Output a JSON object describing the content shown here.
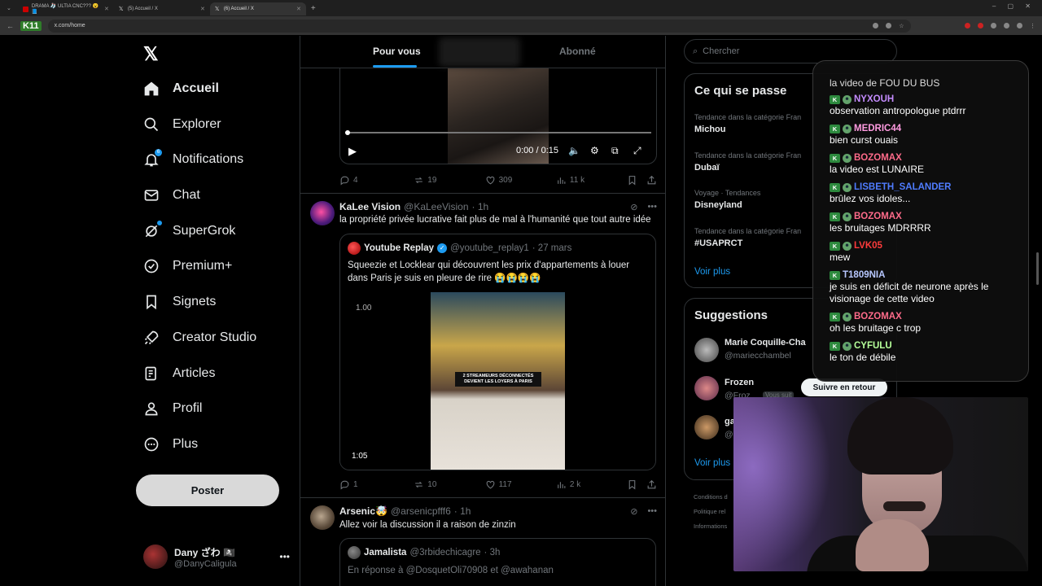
{
  "browser": {
    "tabs": [
      {
        "label": "DRAMA 🧦 ULTIA CNC??? 😮📘",
        "icon": "youtube-icon"
      },
      {
        "label": "(5) Accueil / X",
        "icon": "x-icon"
      },
      {
        "label": "(6) Accueil / X",
        "icon": "x-icon"
      }
    ],
    "url": "x.com/home",
    "stream_logo": "K11"
  },
  "nav": {
    "items": [
      {
        "label": "Accueil",
        "icon": "home-icon"
      },
      {
        "label": "Explorer",
        "icon": "search-icon"
      },
      {
        "label": "Notifications",
        "icon": "bell-icon",
        "badge": "6"
      },
      {
        "label": "Chat",
        "icon": "mail-icon"
      },
      {
        "label": "SuperGrok",
        "icon": "grok-icon"
      },
      {
        "label": "Premium+",
        "icon": "verified-icon"
      },
      {
        "label": "Signets",
        "icon": "bookmark-icon"
      },
      {
        "label": "Creator Studio",
        "icon": "rocket-icon"
      },
      {
        "label": "Articles",
        "icon": "article-icon"
      },
      {
        "label": "Profil",
        "icon": "person-icon"
      },
      {
        "label": "Plus",
        "icon": "more-circle-icon"
      }
    ],
    "post_label": "Poster",
    "profile": {
      "name": "Dany ざわ 🏴‍☠️",
      "handle": "@DanyCaligula"
    }
  },
  "feed": {
    "tabs": {
      "active": "Pour vous",
      "inactive": "Abonné"
    },
    "video1": {
      "time": "0:00 / 0:15",
      "progress": 0.0
    },
    "stats1": {
      "replies": "4",
      "reposts": "19",
      "likes": "309",
      "views": "11 k"
    },
    "tweet2": {
      "name": "KaLee Vision",
      "handle": "@KaLeeVision",
      "time": "· 1h",
      "text": "la propriété privée lucrative fait plus de mal à l'humanité que tout autre idée",
      "quote": {
        "name": "Youtube Replay",
        "handle": "@youtube_replay1",
        "time": "· 27 mars",
        "text": "Squeezie et Locklear qui découvrent les prix d'appartements à louer dans Paris je suis en pleure de rire 😭😭😭😭",
        "media_caption": "2 STREAMEURS DÉCONNECTÉS DEVIENT LES LOYERS À PARIS",
        "media_label": "1.00",
        "duration": "1:05"
      },
      "stats": {
        "replies": "1",
        "reposts": "10",
        "likes": "117",
        "views": "2 k"
      }
    },
    "tweet3": {
      "name": "Arsenic🤯",
      "handle": "@arsenicpfff6",
      "time": "· 1h",
      "text": "Allez voir la discussion il a raison de zinzin",
      "quote": {
        "name": "Jamalista",
        "handle": "@3rbidechicagre",
        "time": "· 3h",
        "reply_to": "En réponse à @DosquetOli70908  et  @awahanan"
      }
    }
  },
  "sidebar": {
    "search_placeholder": "Chercher",
    "trends_title": "Ce qui se passe",
    "trends": [
      {
        "meta": "Tendance dans la catégorie Fran",
        "name": "Michou"
      },
      {
        "meta": "Tendance dans la catégorie Fran",
        "name": "Dubaï"
      },
      {
        "meta": "Voyage · Tendances",
        "name": "Disneyland"
      },
      {
        "meta": "Tendance dans la catégorie Fran",
        "name": "#USAPRCT"
      }
    ],
    "see_more": "Voir plus",
    "suggestions_title": "Suggestions",
    "suggestions": [
      {
        "name": "Marie Coquille-Cha",
        "handle": "@mariecchambel"
      },
      {
        "name": "Frozen",
        "handle": "@Froz",
        "follows_you": "Vous suit"
      },
      {
        "name": "ga",
        "handle": "@"
      }
    ],
    "follow_back": "Suivre en retour",
    "see_more_2": "Voir plus",
    "footer": [
      "Conditions d",
      "Politique rel",
      "Informations"
    ]
  },
  "chat": {
    "top_text": "la video de FOU DU BUS",
    "messages": [
      {
        "user": "NYXOUH",
        "color": "#c58cff",
        "text": "observation antropologue ptdrrr"
      },
      {
        "user": "MEDRIC44",
        "color": "#ff9be0",
        "text": "bien curst ouais"
      },
      {
        "user": "BOZOMAX",
        "color": "#ff6b8a",
        "text": "la video est LUNAIRE"
      },
      {
        "user": "LISBETH_SALANDER",
        "color": "#4f7cff",
        "text": "brûlez vos idoles..."
      },
      {
        "user": "BOZOMAX",
        "color": "#ff6b8a",
        "text": "les bruitages MDRRRR"
      },
      {
        "user": "LVK05",
        "color": "#ff3b3b",
        "text": "mew"
      },
      {
        "user": "T1809NIA",
        "color": "#b7c7ff",
        "text": "je suis en déficit de neurone après le visionage de cette video"
      },
      {
        "user": "BOZOMAX",
        "color": "#ff6b8a",
        "text": "oh les bruitage c trop"
      },
      {
        "user": "CYFULU",
        "color": "#b6ff9a",
        "text": "le ton de débile"
      }
    ]
  }
}
